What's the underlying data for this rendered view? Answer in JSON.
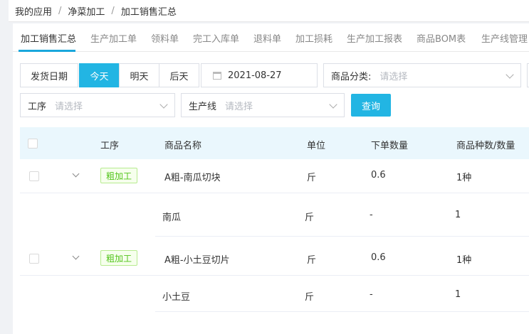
{
  "breadcrumb": [
    "我的应用",
    "净菜加工",
    "加工销售汇总"
  ],
  "tabs": [
    "加工销售汇总",
    "生产加工单",
    "领料单",
    "完工入库单",
    "退料单",
    "加工损耗",
    "生产加工报表",
    "商品BOM表",
    "生产线管理"
  ],
  "active_tab": "加工销售汇总",
  "filters": {
    "date_label": "发货日期",
    "date_buttons": [
      "今天",
      "明天",
      "后天"
    ],
    "date_value": "2021-08-27",
    "category_label": "商品分类:",
    "category_placeholder": "请选择",
    "process_label": "工序",
    "process_placeholder": "请选择",
    "line_label": "生产线",
    "line_placeholder": "请选择",
    "query_button": "查询"
  },
  "table": {
    "headers": [
      "工序",
      "商品名称",
      "单位",
      "下单数量",
      "商品种数/数量"
    ],
    "rows": [
      {
        "process": "粗加工",
        "name": "A粗-南瓜切块",
        "unit": "斤",
        "order_qty": "0.6",
        "kinds": "1种",
        "sub": {
          "name": "南瓜",
          "unit": "斤",
          "order_qty": "-",
          "kinds": "1"
        }
      },
      {
        "process": "粗加工",
        "name": "A粗-小土豆切片",
        "unit": "斤",
        "order_qty": "0.6",
        "kinds": "1种",
        "sub": {
          "name": "小土豆",
          "unit": "斤",
          "order_qty": "-",
          "kinds": "1"
        }
      }
    ]
  },
  "colors": {
    "accent": "#22b5e3",
    "header_bg": "#eaf7fd",
    "tag_green": "#52c41a"
  }
}
